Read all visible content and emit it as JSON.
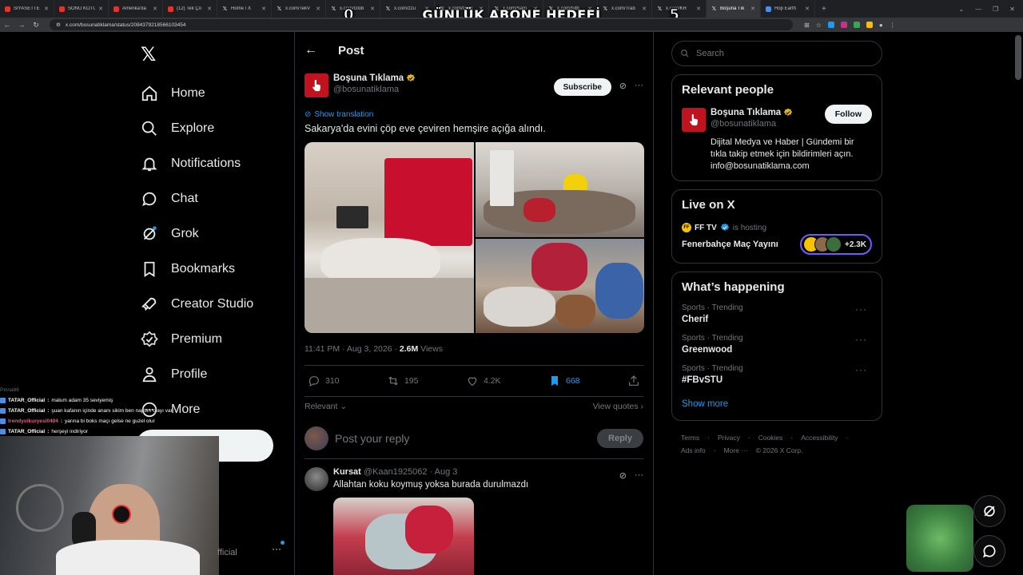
{
  "browser": {
    "tabs": [
      {
        "label": "SİYASETTE",
        "icon": "youtube"
      },
      {
        "label": "SONU KÖTÜ",
        "icon": "youtube"
      },
      {
        "label": "Amerika'da",
        "icon": "youtube"
      },
      {
        "label": "(12) Tek Ço",
        "icon": "youtube"
      },
      {
        "label": "Home / X",
        "icon": "x"
      },
      {
        "label": "x.com/TekV",
        "icon": "x"
      },
      {
        "label": "x.com/Glob",
        "icon": "x"
      },
      {
        "label": "x.com/zzu",
        "icon": "x"
      },
      {
        "label": "x.com/Glob",
        "icon": "x"
      },
      {
        "label": "x.com/Sam",
        "icon": "x"
      },
      {
        "label": "x.com/futb",
        "icon": "x"
      },
      {
        "label": "x.com/Trab",
        "icon": "x"
      },
      {
        "label": "x.com/KR",
        "icon": "x"
      },
      {
        "label": "Boşuna Tık",
        "icon": "x",
        "active": true
      },
      {
        "label": "Hop Earth",
        "icon": "globe"
      }
    ],
    "url": "x.com/bosunatiklama/status/2084379218566103454"
  },
  "stream_overlay": {
    "goal_left": "0",
    "goal_title": "GÜNLÜK ABONE HEDEFİ",
    "goal_right": "5",
    "chat": [
      {
        "user": "TATAR_Official",
        "message": "malum adam 35 seviyemiş",
        "color": "white"
      },
      {
        "user": "TATAR_Official",
        "message": "şuan kafanın içinde ananı sikim ben naptım olayı var",
        "color": "white"
      },
      {
        "user": "trendyolkuryesi0404",
        "message": "yarına bi boks maçı gelse ne guzel olur",
        "color": "pink"
      },
      {
        "user": "TATAR_Official",
        "message": "herşeyi indiriyor",
        "color": "white"
      }
    ],
    "faded_user": "Pinna86"
  },
  "nav": {
    "items": [
      {
        "label": "Home",
        "icon": "home-icon"
      },
      {
        "label": "Explore",
        "icon": "search-icon"
      },
      {
        "label": "Notifications",
        "icon": "bell-icon"
      },
      {
        "label": "Chat",
        "icon": "chat-icon"
      },
      {
        "label": "Grok",
        "icon": "grok-icon"
      },
      {
        "label": "Bookmarks",
        "icon": "bookmark-icon"
      },
      {
        "label": "Creator Studio",
        "icon": "rocket-icon"
      },
      {
        "label": "Premium",
        "icon": "verified-icon"
      },
      {
        "label": "Profile",
        "icon": "person-icon"
      },
      {
        "label": "More",
        "icon": "more-circle-icon"
      }
    ],
    "account_fragment": "fficial"
  },
  "header": {
    "title": "Post"
  },
  "post": {
    "author_name": "Boşuna Tıklama",
    "author_handle": "@bosunatiklama",
    "subscribe_label": "Subscribe",
    "show_translation": "Show translation",
    "text": "Sakarya'da evini çöp eve çeviren hemşire açığa alındı.",
    "time": "11:41 PM · Aug 3, 2026 · ",
    "views_count": "2.6M",
    "views_label": " Views",
    "replies": "310",
    "reposts": "195",
    "likes": "4.2K",
    "bookmarks": "668",
    "relevant_label": "Relevant",
    "view_quotes_label": "View quotes"
  },
  "reply_box": {
    "placeholder": "Post your reply",
    "button_label": "Reply"
  },
  "comment": {
    "name": "Kursat",
    "handle": "@Kaan1925062",
    "date": "· Aug 3",
    "text": "Allahtan koku koymuş yoksa burada durulmazdı"
  },
  "search": {
    "placeholder": "Search"
  },
  "relevant_people": {
    "title": "Relevant people",
    "name": "Boşuna Tıklama",
    "handle": "@bosunatiklama",
    "follow_label": "Follow",
    "bio": "Dijital Medya ve Haber | Gündemi bir tıkla takip etmek için bildirimleri açın. info@bosunatiklama.com"
  },
  "live": {
    "title": "Live on X",
    "host_name": "FF TV",
    "host_suffix": "is hosting",
    "stream_title": "Fenerbahçe Maç Yayını",
    "listener_count": "+2.3K"
  },
  "happening": {
    "title": "What’s happening",
    "trends": [
      {
        "meta": "Sports · Trending",
        "name": "Cherif"
      },
      {
        "meta": "Sports · Trending",
        "name": "Greenwood"
      },
      {
        "meta": "Sports · Trending",
        "name": "#FBvSTU"
      }
    ],
    "show_more": "Show more"
  },
  "footer": {
    "links": [
      "Terms",
      "·",
      "Privacy",
      "·",
      "Cookies",
      "·",
      "Accessibility",
      "·",
      "Ads info",
      "·",
      "More ···",
      "© 2026 X Corp."
    ]
  },
  "colors": {
    "accent": "#1d9bf0",
    "brand_red": "#c1121f",
    "live_purple": "#7856ff"
  }
}
